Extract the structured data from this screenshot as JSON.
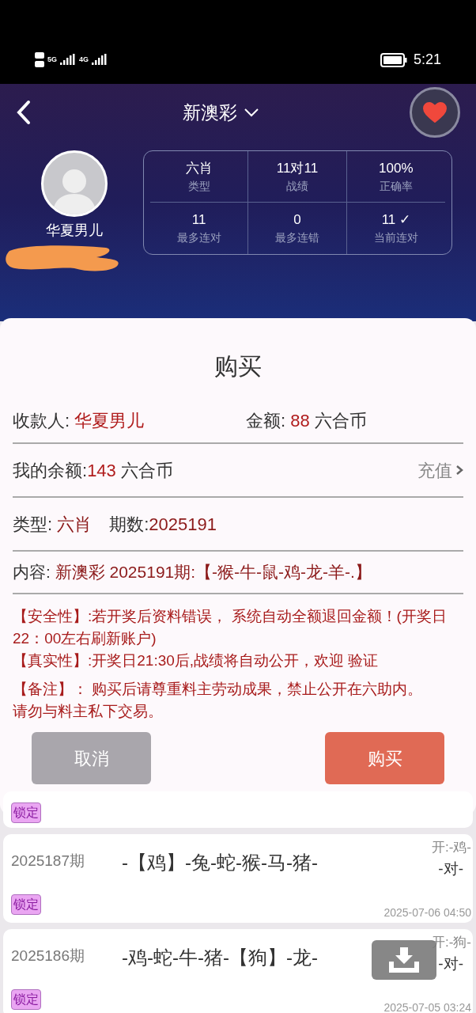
{
  "status_bar": {
    "network_left": "5G",
    "network_right": "4G",
    "time": "5:21"
  },
  "header": {
    "title": "新澳彩",
    "favorite": true
  },
  "profile": {
    "name": "华夏男儿"
  },
  "stats": [
    {
      "value": "六肖",
      "label": "类型"
    },
    {
      "value": "11对11",
      "label": "战绩"
    },
    {
      "value": "100%",
      "label": "正确率"
    },
    {
      "value": "11",
      "label": "最多连对"
    },
    {
      "value": "0",
      "label": "最多连错"
    },
    {
      "value": "11 ✓",
      "label": "当前连对"
    }
  ],
  "dialog": {
    "title": "购买",
    "payee_label": "收款人: ",
    "payee": "华夏男儿",
    "amount_label": "金额: ",
    "amount": "88",
    "amount_unit": " 六合币",
    "balance_label": "我的余额:",
    "balance": "143",
    "balance_unit": " 六合币",
    "recharge": "充值",
    "type_label": "类型: ",
    "type": "六肖",
    "period_label": "期数:",
    "period": "2025191",
    "content_label": "内容: ",
    "content": "新澳彩 2025191期:【-猴-牛-鼠-鸡-龙-羊-.】",
    "notes": [
      "【安全性】:若开奖后资料错误， 系统自动全额退回金额！(开奖日22：00左右刷新账户)",
      "【真实性】:开奖日21:30后,战绩将自动公开，欢迎 验证",
      "【备注】： 购买后请尊重料主劳动成果，禁止公开在六助内。",
      "请勿与料主私下交易。"
    ],
    "cancel": "取消",
    "confirm": "购买"
  },
  "partial_card_badge": "锁定",
  "records": [
    {
      "period": "2025187期",
      "picks": "-【鸡】-兔-蛇-猴-马-猪-",
      "result": "开:-鸡-",
      "verdict": "-对-",
      "time": "2025-07-06 04:50",
      "badge": "锁定"
    },
    {
      "period": "2025186期",
      "picks": "-鸡-蛇-牛-猪-【狗】-龙-",
      "result": "开:-狗-",
      "verdict": "-对-",
      "time": "2025-07-05 03:24",
      "badge": "锁定"
    }
  ]
}
